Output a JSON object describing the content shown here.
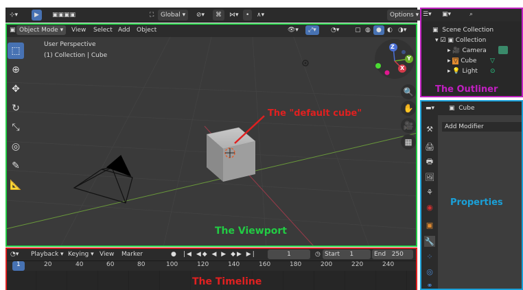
{
  "topbar": {
    "orientation": "Global",
    "options": "Options"
  },
  "viewport": {
    "header": {
      "mode": "Object Mode",
      "view": "View",
      "select": "Select",
      "add": "Add",
      "object": "Object"
    },
    "overlay": {
      "perspective": "User Perspective",
      "collection": "(1) Collection | Cube"
    },
    "gizmo": {
      "z": "Z",
      "y": "Y",
      "x": "X"
    }
  },
  "outliner": {
    "scene_collection": "Scene Collection",
    "items": [
      {
        "label": "Collection"
      },
      {
        "label": "Camera"
      },
      {
        "label": "Cube"
      },
      {
        "label": "Light"
      }
    ]
  },
  "properties": {
    "object_name": "Cube",
    "add_modifier": "Add Modifier"
  },
  "timeline": {
    "menus": [
      "Playback",
      "Keying",
      "View",
      "Marker"
    ],
    "current_frame": "1",
    "start_label": "Start",
    "start_value": "1",
    "end_label": "End",
    "end_value": "250",
    "frames": [
      "1",
      "20",
      "40",
      "60",
      "80",
      "100",
      "120",
      "140",
      "160",
      "180",
      "200",
      "220",
      "240"
    ]
  },
  "annotations": {
    "default_cube": "The \"default cube\"",
    "outliner": "The Outliner",
    "properties": "Properties",
    "viewport": "The Viewport",
    "timeline": "The Timeline"
  },
  "colors": {
    "viewport_frame": "#22cc44",
    "outliner_frame": "#c020c0",
    "properties_frame": "#1aa0d8",
    "timeline_frame": "#e02020",
    "accent": "#4772b3"
  }
}
